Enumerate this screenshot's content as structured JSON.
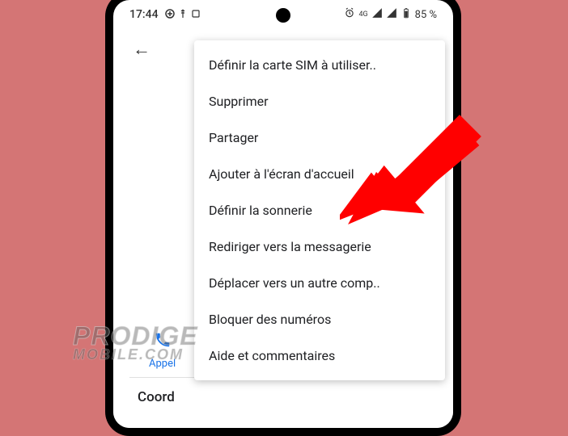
{
  "status_bar": {
    "time": "17:44",
    "network_label": "4G",
    "battery_percent": "85 %"
  },
  "header": {
    "back_arrow": "←"
  },
  "background": {
    "tab_call_label": "Appel",
    "section_label": "Coord"
  },
  "menu": {
    "items": [
      "Définir la carte SIM à utiliser..",
      "Supprimer",
      "Partager",
      "Ajouter à l'écran d'accueil",
      "Définir la sonnerie",
      "Rediriger vers la messagerie",
      "Déplacer vers un autre comp..",
      "Bloquer des numéros",
      "Aide et commentaires"
    ]
  },
  "watermark": {
    "line1": "PRODIGE",
    "line2": "MOBILE.COM"
  }
}
